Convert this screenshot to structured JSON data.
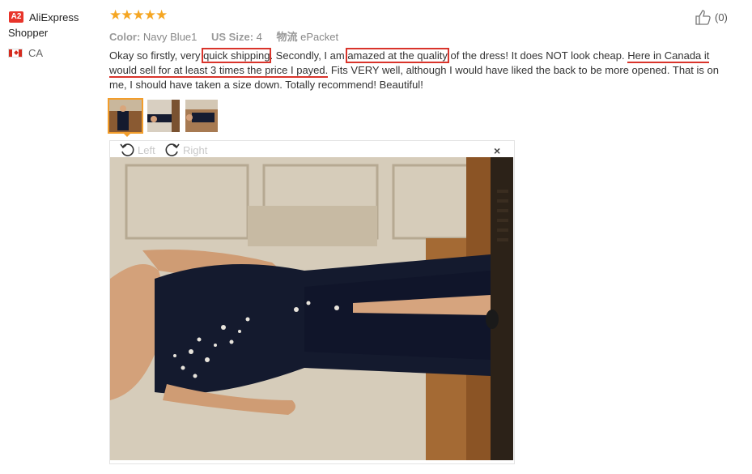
{
  "user": {
    "level_badge": "A2",
    "name": "AliExpress Shopper",
    "country": "CA"
  },
  "review": {
    "stars": "★★★★★",
    "color_label": "Color:",
    "color_value": "Navy Blue1",
    "size_label": "US Size:",
    "size_value": "4",
    "shipping_label": "物流",
    "shipping_value": "ePacket",
    "helpful_count": "(0)",
    "text": {
      "p1": "Okay so firstly, very ",
      "h1": "quick shipping",
      "p2": ". Secondly, I am ",
      "h2": "amazed at the quality",
      "p3": " of the dress! It does NOT look cheap. ",
      "u1": "Here in Canada it would sell for at least 3 times the price I payed.",
      "p4": " Fits VERY well, although I would have liked the back to be more opened. That is on me, I should have taken a size down. Totally recommend! Beautiful!"
    }
  },
  "viewer": {
    "rotate_left": "Left",
    "rotate_right": "Right",
    "close": "×"
  },
  "colors": {
    "highlight": "#d9342b",
    "star": "#f5a623",
    "badge": "#e8342a",
    "thumb_selected": "#f29d2b"
  }
}
